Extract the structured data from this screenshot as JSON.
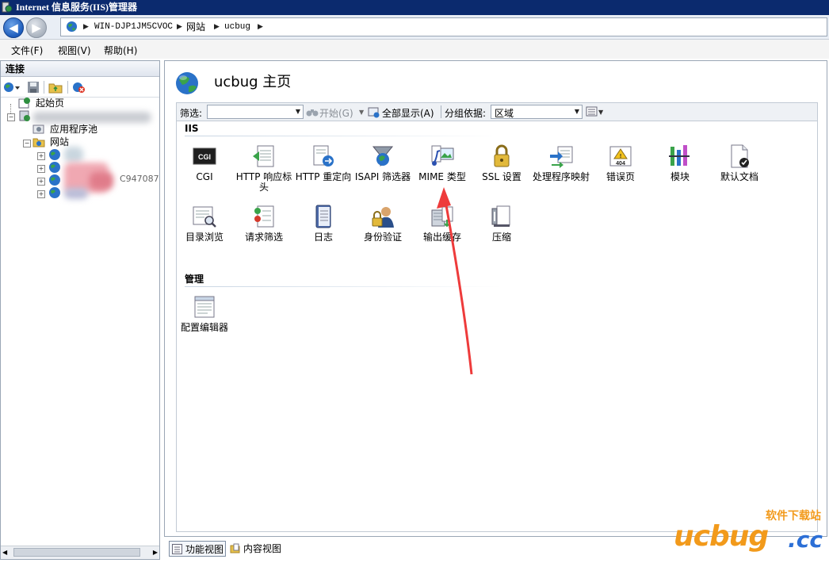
{
  "window": {
    "title": "Internet 信息服务(IIS)管理器"
  },
  "address": {
    "segments": [
      "WIN-DJP1JM5CVOC",
      "网站",
      "ucbug"
    ],
    "separator": "▶"
  },
  "menu": [
    "文件(F)",
    "视图(V)",
    "帮助(H)"
  ],
  "sidebar": {
    "title": "连接",
    "tree": {
      "start_page": "起始页",
      "app_pools": "应用程序池",
      "sites": "网站",
      "partial_site_suffix": "C947087"
    }
  },
  "main": {
    "title": "ucbug 主页",
    "filter": {
      "label": "筛选:",
      "go": "开始(G)",
      "show_all": "全部显示(A)",
      "group_label": "分组依据:",
      "group_value": "区域"
    },
    "sections": [
      {
        "title": "IIS",
        "items": [
          {
            "label": "CGI",
            "icon": "cgi-icon"
          },
          {
            "label": "HTTP 响应标头",
            "icon": "http-response-headers-icon"
          },
          {
            "label": "HTTP 重定向",
            "icon": "http-redirect-icon"
          },
          {
            "label": "ISAPI 筛选器",
            "icon": "isapi-filters-icon"
          },
          {
            "label": "MIME 类型",
            "icon": "mime-types-icon"
          },
          {
            "label": "SSL 设置",
            "icon": "ssl-settings-icon"
          },
          {
            "label": "处理程序映射",
            "icon": "handler-mappings-icon"
          },
          {
            "label": "错误页",
            "icon": "error-pages-icon"
          },
          {
            "label": "模块",
            "icon": "modules-icon"
          },
          {
            "label": "默认文档",
            "icon": "default-document-icon"
          },
          {
            "label": "目录浏览",
            "icon": "directory-browsing-icon"
          },
          {
            "label": "请求筛选",
            "icon": "request-filtering-icon"
          },
          {
            "label": "日志",
            "icon": "logging-icon"
          },
          {
            "label": "身份验证",
            "icon": "authentication-icon"
          },
          {
            "label": "输出缓存",
            "icon": "output-caching-icon"
          },
          {
            "label": "压缩",
            "icon": "compression-icon"
          }
        ]
      },
      {
        "title": "管理",
        "items": [
          {
            "label": "配置编辑器",
            "icon": "configuration-editor-icon"
          }
        ]
      }
    ]
  },
  "bottom_tabs": [
    "功能视图",
    "内容视图"
  ],
  "watermark": {
    "top": "软件下载站",
    "brand": "ucbug",
    "tld": ".cc"
  },
  "colors": {
    "title_bar": "#0b2a6e",
    "annotation_arrow": "#ee3b3b",
    "watermark_orange": "#f29a1b",
    "watermark_blue": "#2c6fd6"
  }
}
